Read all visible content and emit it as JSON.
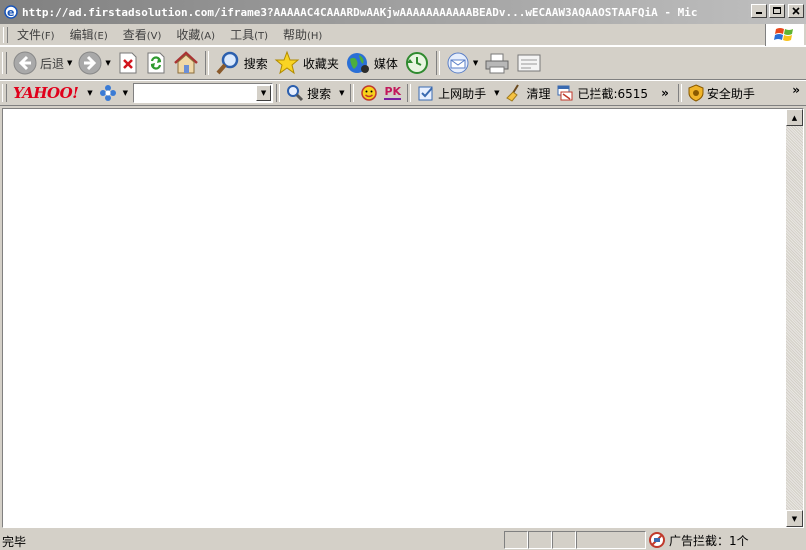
{
  "window": {
    "title": "http://ad.firstadsolution.com/iframe3?AAAAAC4CAAARDwAAKjwAAAAAAAAAAABEADv...wECAAW3AQAAOSTAAFQiA - Mic"
  },
  "menu": [
    {
      "label": "文件",
      "acc": "(F)"
    },
    {
      "label": "编辑",
      "acc": "(E)"
    },
    {
      "label": "查看",
      "acc": "(V)"
    },
    {
      "label": "收藏",
      "acc": "(A)"
    },
    {
      "label": "工具",
      "acc": "(T)"
    },
    {
      "label": "帮助",
      "acc": "(H)"
    }
  ],
  "toolbar": {
    "back": "后退",
    "search": "搜索",
    "favorites": "收藏夹",
    "media": "媒体"
  },
  "yahoo_bar": {
    "logo": "YAHOO!",
    "search_value": "",
    "search_label": "搜索",
    "pk": "PK",
    "assistant": "上网助手",
    "clean": "清理",
    "blocked": "已拦截:6515",
    "chevron": "»",
    "security": "安全助手",
    "chevron_right": "»"
  },
  "status": {
    "text": "完毕",
    "ad_block": "广告拦截：1个"
  },
  "colors": {
    "chrome": "#d4d0c8",
    "yahoo_red": "#e0001b"
  },
  "icons": [
    "ie-icon",
    "back-icon",
    "forward-icon",
    "stop-icon",
    "refresh-icon",
    "home-icon",
    "search-icon",
    "favorites-star-icon",
    "media-globe-icon",
    "history-icon",
    "mail-icon",
    "print-icon",
    "edit-icon"
  ]
}
